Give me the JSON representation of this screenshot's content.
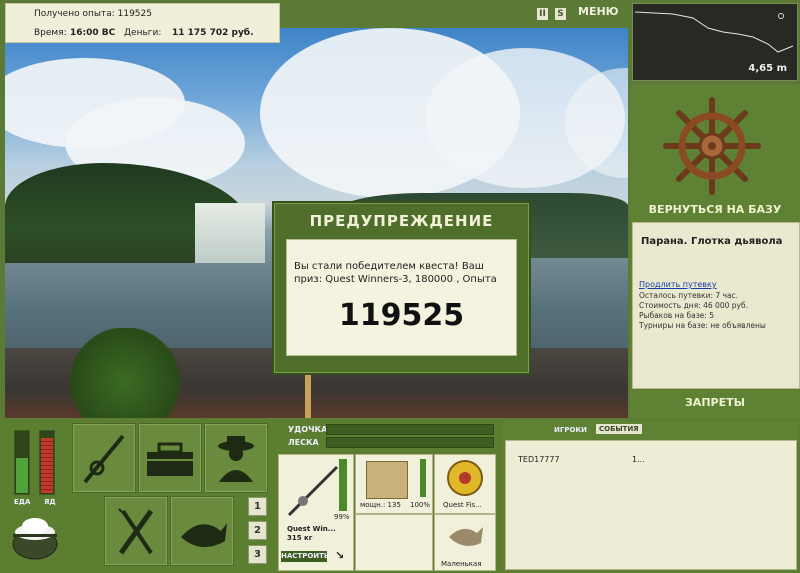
{
  "top_info": {
    "xp_label": "Получено опыта:",
    "xp_value": "119525",
    "time_label": "Время:",
    "time_value": "16:00 ВС",
    "money_label": "Деньги:",
    "money_value": "11 175 702 руб."
  },
  "top_buttons": {
    "pause": "II",
    "sound": "S",
    "menu": "МЕНЮ"
  },
  "minimap": {
    "depth": "4,65 m"
  },
  "right_panel": {
    "return_label": "ВЕРНУТЬСЯ НА БАЗУ",
    "location": "Парана. Глотка дьявола",
    "extend_link": "Продлить путевку",
    "stats": [
      "Осталось путевки: 7 час.",
      "Стоимость дня: 46 000 руб.",
      "Рыбаков на базе: 5",
      "Турниры на базе: не объявлены"
    ],
    "bans_label": "ЗАПРЕТЫ"
  },
  "dialog": {
    "title": "ПРЕДУПРЕЖДЕНИЕ",
    "message": "Вы стали победителем квеста! Ваш приз: Quest Winners-3, 180000 , Опыта",
    "value": "119525"
  },
  "gauges": {
    "food_label": "ЕДА",
    "poison_label": "ЯД"
  },
  "tackle": {
    "rod_label": "УДОЧКА",
    "line_label": "ЛЕСКА",
    "rod_percent": "99%",
    "rod_name": "Quest Win...",
    "rod_weight": "315 кг",
    "setup_button": "НАСТРОИТЬ",
    "reel_power": "мощн.: 135",
    "reel_percent": "100%",
    "line_name": "Quest Fis...",
    "bait_name": "Маленькая"
  },
  "page_buttons": [
    "1",
    "2",
    "3"
  ],
  "events": {
    "tab_players": "ИГРОКИ",
    "tab_events": "СОБЫТИЯ",
    "row_name": "TED17777",
    "row_value": "1..."
  },
  "colors": {
    "panel_green": "#5e8133",
    "cream": "#f1f0da",
    "dark_green": "#3f5e22"
  }
}
